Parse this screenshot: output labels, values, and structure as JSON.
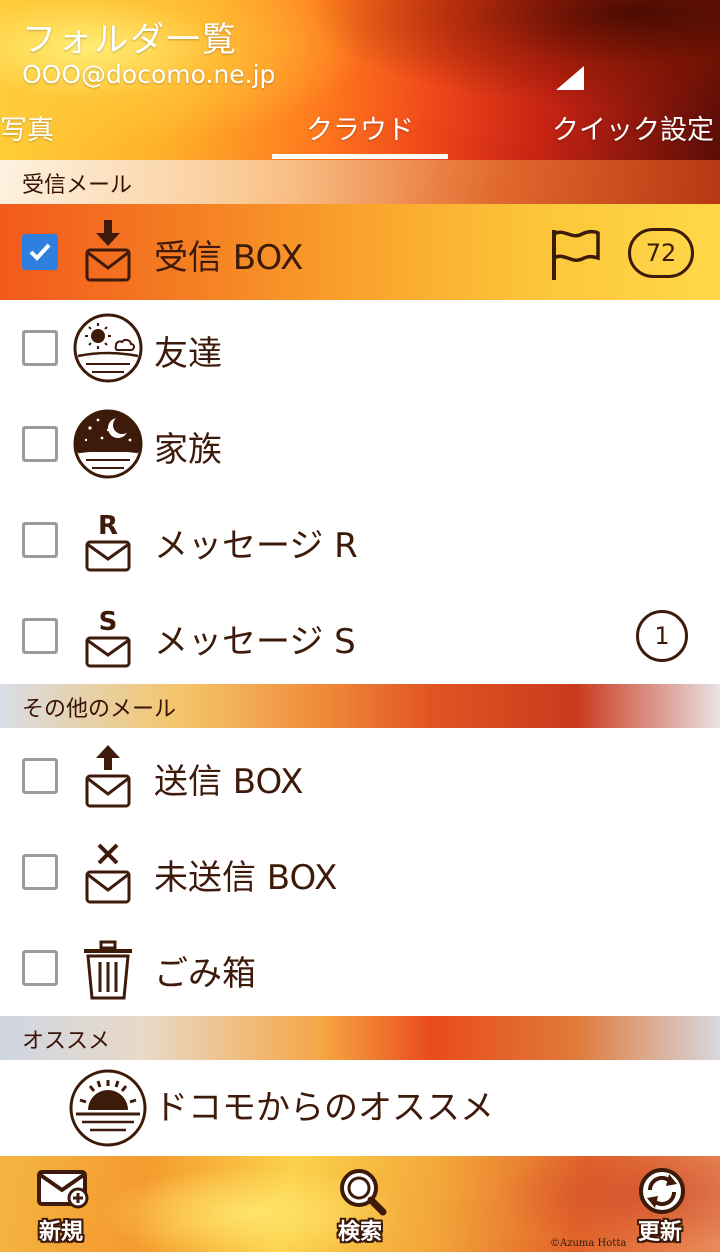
{
  "header": {
    "title": "フォルダ一覧",
    "account": "OOO@docomo.ne.jp"
  },
  "tabs": [
    {
      "label": "写真"
    },
    {
      "label": "クラウド",
      "selected": true
    },
    {
      "label": "クイック設定"
    }
  ],
  "sections": {
    "inbox_header": "受信メール",
    "other_header": "その他のメール",
    "recommend_header": "オススメ"
  },
  "folders": {
    "inbox": {
      "label": "受信 BOX",
      "icon": "inbox-download-icon",
      "checked": true,
      "flag": true,
      "count": "72"
    },
    "friends": {
      "label": "友達",
      "icon": "sun-landscape-icon",
      "checked": false
    },
    "family": {
      "label": "家族",
      "icon": "moon-night-icon",
      "checked": false
    },
    "message_r": {
      "label": "メッセージ R",
      "icon": "envelope-r-icon",
      "checked": false
    },
    "message_s": {
      "label": "メッセージ S",
      "icon": "envelope-s-icon",
      "checked": false,
      "count": "1"
    },
    "sent": {
      "label": "送信 BOX",
      "icon": "envelope-upload-icon",
      "checked": false
    },
    "unsent": {
      "label": "未送信 BOX",
      "icon": "envelope-x-icon",
      "checked": false
    },
    "trash": {
      "label": "ごみ箱",
      "icon": "trash-icon",
      "checked": false
    },
    "docomo_recommend": {
      "label": "ドコモからのオススメ",
      "icon": "sunrise-icon"
    }
  },
  "toolbar": {
    "new_label": "新規",
    "search_label": "検索",
    "refresh_label": "更新"
  },
  "copyright": "©Azuma Hotta",
  "colors": {
    "text_brown": "#3d1a0a",
    "checkbox_blue": "#2f7fe0",
    "checkbox_gray": "#9b9b9b"
  }
}
